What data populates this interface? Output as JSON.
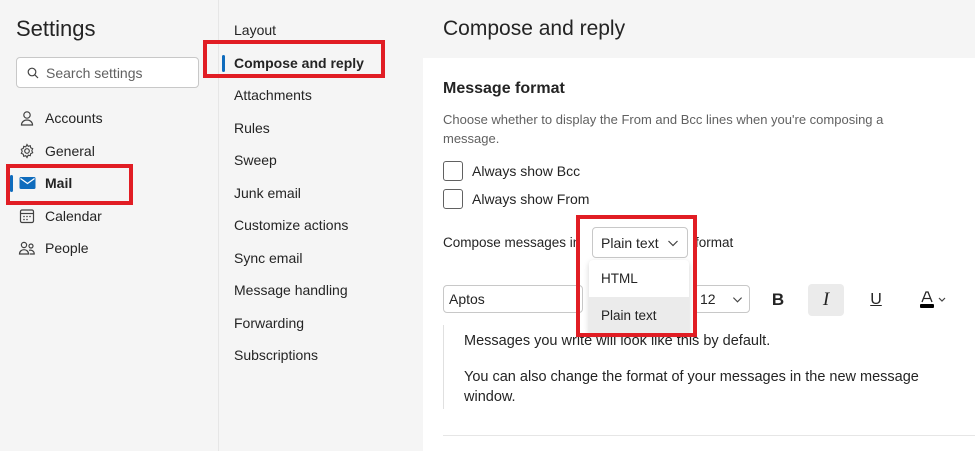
{
  "sidebar": {
    "title": "Settings",
    "search_placeholder": "Search settings",
    "items": [
      {
        "label": "Accounts",
        "icon": "person-icon"
      },
      {
        "label": "General",
        "icon": "gear-icon"
      },
      {
        "label": "Mail",
        "icon": "mail-icon",
        "active": true
      },
      {
        "label": "Calendar",
        "icon": "calendar-icon"
      },
      {
        "label": "People",
        "icon": "people-icon"
      }
    ]
  },
  "subnav": {
    "items": [
      {
        "label": "Layout"
      },
      {
        "label": "Compose and reply",
        "active": true
      },
      {
        "label": "Attachments"
      },
      {
        "label": "Rules"
      },
      {
        "label": "Sweep"
      },
      {
        "label": "Junk email"
      },
      {
        "label": "Customize actions"
      },
      {
        "label": "Sync email"
      },
      {
        "label": "Message handling"
      },
      {
        "label": "Forwarding"
      },
      {
        "label": "Subscriptions"
      }
    ]
  },
  "main": {
    "title": "Compose and reply",
    "message_format": {
      "heading": "Message format",
      "description": "Choose whether to display the From and Bcc lines when you're composing a message.",
      "always_show_bcc": "Always show Bcc",
      "always_show_from": "Always show From",
      "compose_label": "Compose messages in",
      "format_suffix": "format",
      "selected_format": "Plain text",
      "format_options": [
        "HTML",
        "Plain text"
      ]
    },
    "toolbar": {
      "font": "Aptos",
      "size": "12",
      "bold": "B",
      "italic": "I",
      "underline": "U"
    },
    "preview": {
      "line1": "Messages you write will look like this by default.",
      "line2": "You can also change the format of your messages in the new message window."
    }
  },
  "colors": {
    "accent": "#0f6cbd",
    "highlight": "#e11d24",
    "pane_bg": "#f5f5f5"
  }
}
